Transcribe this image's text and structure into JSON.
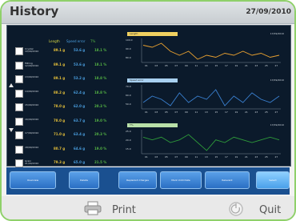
{
  "header": {
    "title": "History",
    "date": "27/09/2010"
  },
  "table": {
    "columns": [
      "Length",
      "Speed error",
      "T%"
    ],
    "rows": [
      {
        "label": "Crystal 10/09/2010",
        "v1": "89.1 g",
        "v2": "53.6 g",
        "v3": "18.1 %"
      },
      {
        "label": "Milling 12/09/2010",
        "v1": "89.1 g",
        "v2": "53.6 g",
        "v3": "18.1 %"
      },
      {
        "label": "13/09/2010",
        "v1": "89.1 g",
        "v2": "53.2 g",
        "v3": "18.8 %"
      },
      {
        "label": "14/09/2010",
        "v1": "88.2 g",
        "v2": "62.4 g",
        "v3": "18.8 %"
      },
      {
        "label": "15/09/2010",
        "v1": "78.0 g",
        "v2": "62.0 g",
        "v3": "20.3 %"
      },
      {
        "label": "16/09/2010",
        "v1": "78.0 g",
        "v2": "63.7 g",
        "v3": "19.0 %"
      },
      {
        "label": "17/09/2010",
        "v1": "71.0 g",
        "v2": "63.4 g",
        "v3": "20.3 %"
      },
      {
        "label": "18/09/2010",
        "v1": "80.7 g",
        "v2": "64.6 g",
        "v3": "19.0 %"
      },
      {
        "label": "Grain 21/09/2010",
        "v1": "79.3 g",
        "v2": "65.0 g",
        "v3": "21.5 %"
      }
    ],
    "total_label": "TOTAL",
    "chosen_label": "CHOSEN"
  },
  "charts": [
    {
      "legend": "Length",
      "legend_color": "#f0d060",
      "right_label": "17/09/2010",
      "line_color": "#e8a030",
      "ticks": [
        "100.0",
        "90.0",
        "80.0"
      ],
      "values": [
        89,
        88,
        90,
        86,
        84,
        86,
        82,
        84,
        83,
        85,
        84,
        86,
        84,
        85,
        83,
        84
      ]
    },
    {
      "legend": "Speed error",
      "legend_color": "#a8d0f0",
      "right_label": "17/09/2010",
      "line_color": "#3a80d0",
      "ticks": [
        "70.0",
        "60.0",
        "50.0"
      ],
      "values": [
        58,
        60,
        59,
        57,
        61,
        58,
        60,
        59,
        62,
        57,
        60,
        58,
        61,
        59,
        58,
        60
      ]
    },
    {
      "legend": "T%",
      "legend_color": "#b8e0a8",
      "right_label": "17/09/2010",
      "line_color": "#2e9a3a",
      "ticks": [
        "25.0",
        "20.0",
        "15.0"
      ],
      "values": [
        20,
        19,
        20,
        18,
        19,
        21,
        18,
        15,
        19,
        18,
        20,
        19,
        18,
        19,
        20,
        19
      ]
    }
  ],
  "x_ticks": [
    "01",
    "03",
    "05",
    "07",
    "09",
    "11",
    "13",
    "15",
    "17",
    "19",
    "21",
    "23",
    "25",
    "27"
  ],
  "buttons": [
    "Overview",
    "Delete",
    "Replenish Charges",
    "Mark Until Date",
    "Relevant",
    "Select"
  ],
  "footer": {
    "print_label": "Print",
    "quit_label": "Quit"
  }
}
